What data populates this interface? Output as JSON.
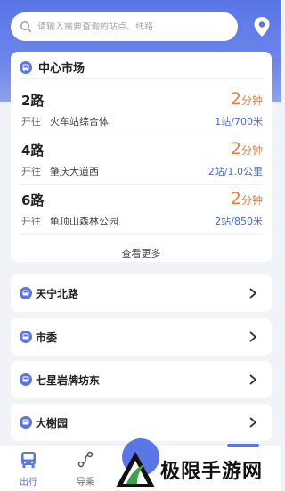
{
  "search": {
    "placeholder": "请输入需要查询的站点、线路"
  },
  "icons": {
    "search": "search-icon",
    "location": "location-pin-icon",
    "bus": "bus-stop-icon",
    "chevron": "chevron-right-icon"
  },
  "colors": {
    "primary": "#5a76e6",
    "eta": "#f07a37",
    "distance": "#4a6be0"
  },
  "main_stop": {
    "name": "中心市场",
    "routes": [
      {
        "name": "2路",
        "dir_prefix": "开往",
        "dest": "火车站综合体",
        "eta_num": "2",
        "eta_unit": "分钟",
        "distance": "1站/700米"
      },
      {
        "name": "4路",
        "dir_prefix": "开往",
        "dest": "肇庆大道西",
        "eta_num": "2",
        "eta_unit": "分钟",
        "distance": "2站/1.0公里"
      },
      {
        "name": "6路",
        "dir_prefix": "开往",
        "dest": "龟顶山森林公园",
        "eta_num": "2",
        "eta_unit": "分钟",
        "distance": "2站/850米"
      }
    ],
    "more_label": "查看更多"
  },
  "nearby_stops": [
    "天宁北路",
    "市委",
    "七星岩牌坊东",
    "大榭园"
  ],
  "tabs": [
    {
      "label": "出行",
      "icon": "bus-front-icon",
      "active": true
    },
    {
      "label": "导乘",
      "icon": "route-icon",
      "active": false
    }
  ],
  "watermark": {
    "text": "极限手游网"
  }
}
